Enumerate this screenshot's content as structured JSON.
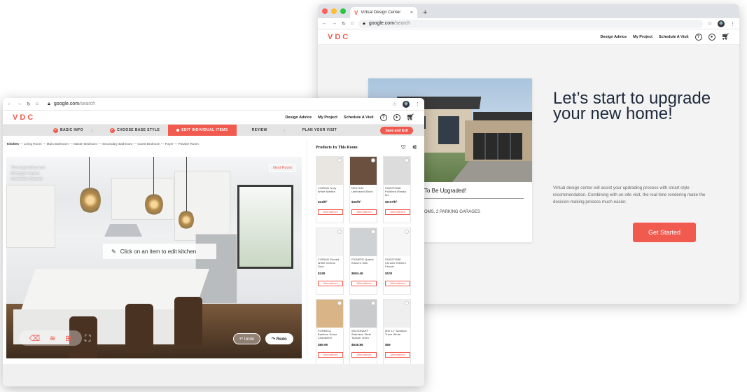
{
  "back": {
    "tab_title": "Virtual Design Center",
    "tab_close": "×",
    "new_tab": "+",
    "url_host": "google.com",
    "url_path": "/search",
    "brand": "VDC",
    "nav": [
      "Design Advice",
      "My Project",
      "Schedule A Visit"
    ],
    "card_title": "To Be Upgraded!",
    "card_sub": "OMS, 2 PARKING GARAGES",
    "headline": "Let’s start to upgrade your new home!",
    "description": "Virtual design center will assist your updrading process with smart style recommendation. Combining with on-site visit, the real-time rendering make the decision-making process much easier.",
    "cta": "Get Started"
  },
  "front": {
    "url_host": "google.com",
    "url_path": "/search",
    "brand": "VDC",
    "nav": [
      "Design Advice",
      "My Project",
      "Schedule A Visit"
    ],
    "steps": [
      {
        "label": "BASIC INFO",
        "state": "done"
      },
      {
        "label": "CHOOSE BASE STYLE",
        "state": "done"
      },
      {
        "label": "EDIT INDIVIDUAL ITEMS",
        "state": "active"
      },
      {
        "label": "REVIEW",
        "state": "pending"
      },
      {
        "label": "PLAN YOUR VISIT",
        "state": "pending"
      }
    ],
    "save_exit": "Save and Exit",
    "breadcrumb_current": "Kitchen",
    "breadcrumb_rest": " — Living Room — Main Bathroom — Master Bedroom — Secondary Bathroom — Guest Bedroom — Foyer — Powder Room",
    "cost_labels": [
      "Total upgrading cost:",
      "Mortgage Impact:",
      "Immediate Deposit:"
    ],
    "next_room": "Next Room",
    "click_hint": "Click on an item to edit kitchen",
    "undo": "Undo",
    "redo": "Redo",
    "panel_title": "Products In This Room",
    "alternatives": "Alternatives",
    "products": [
      {
        "name": "CORIAN Ivory White Marble",
        "price": "$24/ft²",
        "swatch": "#e9e6e1"
      },
      {
        "name": "DEKTON Unfinished Birch",
        "price": "$35/ft²",
        "swatch": "#6b5040"
      },
      {
        "name": "SILESTONE Polished Mosaic tile",
        "price": "$9.97/ft²",
        "swatch": "#dcdcdc"
      },
      {
        "name": "CORIAN Primed White Interior Door",
        "price": "$249",
        "swatch": "#f3f3f3"
      },
      {
        "name": "PIONEFE Quartz Kitchen Sink",
        "price": "$584.46",
        "swatch": "#cfd2d4"
      },
      {
        "name": "SILESTONE Chrome Kitchen Faucet",
        "price": "$100",
        "swatch": "#f6f6f6"
      },
      {
        "name": "FORMICA Bamboo Dome Chandelier",
        "price": "$89.99",
        "swatch": "#d9b487"
      },
      {
        "name": "WILSONART Stainless Steel Toaster Oven",
        "price": "$549.89",
        "swatch": "#c9cbcd"
      },
      {
        "name": "MSI 12\" Modular Track White",
        "price": "$59",
        "swatch": "#efefef"
      }
    ]
  },
  "colors": {
    "accent": "#f15a4f",
    "headline": "#1e2a3b"
  }
}
